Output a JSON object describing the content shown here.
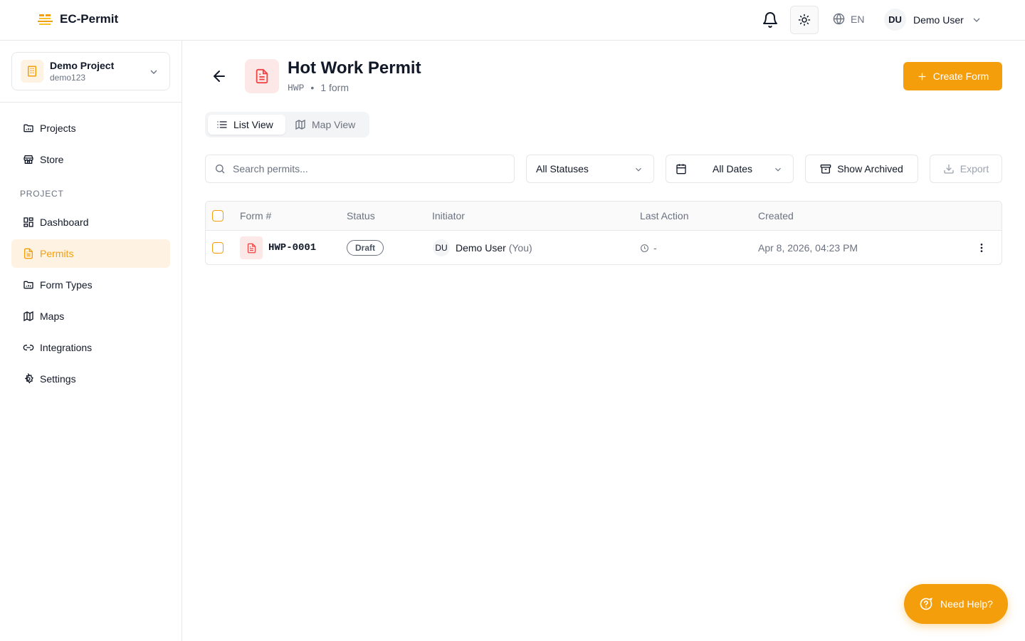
{
  "app": {
    "name": "EC-Permit",
    "brand_color": "#f59e0b"
  },
  "header": {
    "language": "EN",
    "user_initials": "DU",
    "user_name": "Demo User"
  },
  "project": {
    "name": "Demo Project",
    "code": "demo123"
  },
  "sidebar": {
    "top_items": [
      {
        "label": "Projects",
        "icon": "folder-icon"
      },
      {
        "label": "Store",
        "icon": "store-icon"
      }
    ],
    "section_label": "PROJECT",
    "items": [
      {
        "label": "Dashboard",
        "icon": "dashboard-icon"
      },
      {
        "label": "Permits",
        "icon": "file-text-icon",
        "active": true
      },
      {
        "label": "Form Types",
        "icon": "folder-icon"
      },
      {
        "label": "Maps",
        "icon": "map-icon"
      },
      {
        "label": "Integrations",
        "icon": "link-icon"
      },
      {
        "label": "Settings",
        "icon": "gear-icon"
      }
    ]
  },
  "page": {
    "title": "Hot Work Permit",
    "code": "HWP",
    "separator": "•",
    "count_text": "1 form",
    "create_label": "Create Form"
  },
  "views": {
    "list": "List View",
    "map": "Map View",
    "selected": "List View"
  },
  "filters": {
    "search_placeholder": "Search permits...",
    "status": "All Statuses",
    "dates": "All Dates",
    "archived_label": "Show Archived",
    "export_label": "Export"
  },
  "table": {
    "columns": [
      "Form #",
      "Status",
      "Initiator",
      "Last Action",
      "Created"
    ],
    "rows": [
      {
        "form_no": "HWP-0001",
        "status": "Draft",
        "initiator_initials": "DU",
        "initiator": "Demo User",
        "initiator_suffix": "(You)",
        "last_action": "-",
        "created": "Apr 8, 2026, 04:23 PM"
      }
    ]
  },
  "help": {
    "label": "Need Help?"
  }
}
